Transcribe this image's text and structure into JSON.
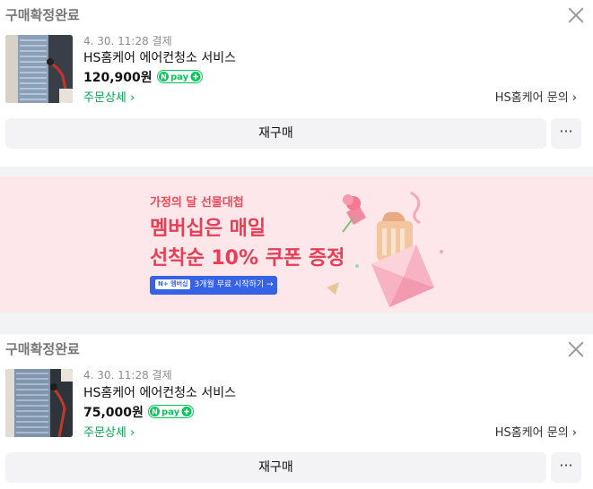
{
  "orders": [
    {
      "status": "구매확정완료",
      "date": "4. 30. 11:28 결제",
      "title": "HS홈케어 에어컨청소 서비스",
      "price": "120,900원",
      "pay_badge": "pay",
      "detail_link": "주문상세 ›",
      "inquiry_link": "HS홈케어 문의 ›",
      "rebuy_label": "재구매",
      "more_label": "···"
    },
    {
      "status": "구매확정완료",
      "date": "4. 30. 11:28 결제",
      "title": "HS홈케어 에어컨청소 서비스",
      "price": "75,000원",
      "pay_badge": "pay",
      "detail_link": "주문상세 ›",
      "inquiry_link": "HS홈케어 문의 ›",
      "rebuy_label": "재구매",
      "more_label": "···"
    }
  ],
  "banner": {
    "kicker": "가정의 달 선물대첩",
    "headline1": "멤버십은 매일",
    "headline2": "선착순 10% 쿠폰 증정",
    "cta_badge": "N+ 멤버십",
    "cta": "3개월 무료 시작하기 →"
  },
  "colors": {
    "accent_green": "#00a64f",
    "npay_green": "#03c75a",
    "banner_bg": "#fde7ea",
    "banner_text": "#e83d54",
    "cta_blue": "#3762e5"
  }
}
